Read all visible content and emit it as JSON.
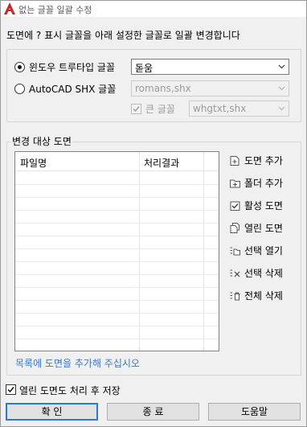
{
  "window": {
    "title": "없는 글꼴 일괄 수정",
    "brand_color": "#c7242b"
  },
  "prompt": "도면에 ? 표시 글꼴을 아래 설정한 글꼴로 일괄 변경합니다",
  "font_options": {
    "truetype_label": "윈도우 트루타입 글꼴",
    "truetype_value": "돋움",
    "truetype_selected": true,
    "shx_label": "AutoCAD  SHX 글꼴",
    "shx_value": "romans,shx",
    "big_font_label": "큰 글꼴",
    "big_font_value": "whgtxt,shx",
    "big_font_checked": true
  },
  "target_group": {
    "title": "변경 대상 도면",
    "columns": [
      "파일명",
      "처리결과"
    ],
    "rows": [],
    "hint": "목록에 도면을 추가해 주십시오",
    "hint_color": "#3a78c2"
  },
  "side_buttons": [
    {
      "label": "도면 추가",
      "icon": "add-drawing-icon"
    },
    {
      "label": "폴더 추가",
      "icon": "add-folder-icon"
    },
    {
      "label": "활성 도면",
      "icon": "active-drawing-icon"
    },
    {
      "label": "열린 도면",
      "icon": "open-drawings-icon"
    },
    {
      "label": "선택 열기",
      "icon": "open-selected-icon"
    },
    {
      "label": "선택 삭제",
      "icon": "delete-selected-icon"
    },
    {
      "label": "전체 삭제",
      "icon": "delete-all-icon"
    }
  ],
  "save_option": {
    "label": "열린 도면도 처리 후 저장",
    "checked": true
  },
  "buttons": {
    "ok": "확 인",
    "close": "종 료",
    "help": "도움말"
  }
}
